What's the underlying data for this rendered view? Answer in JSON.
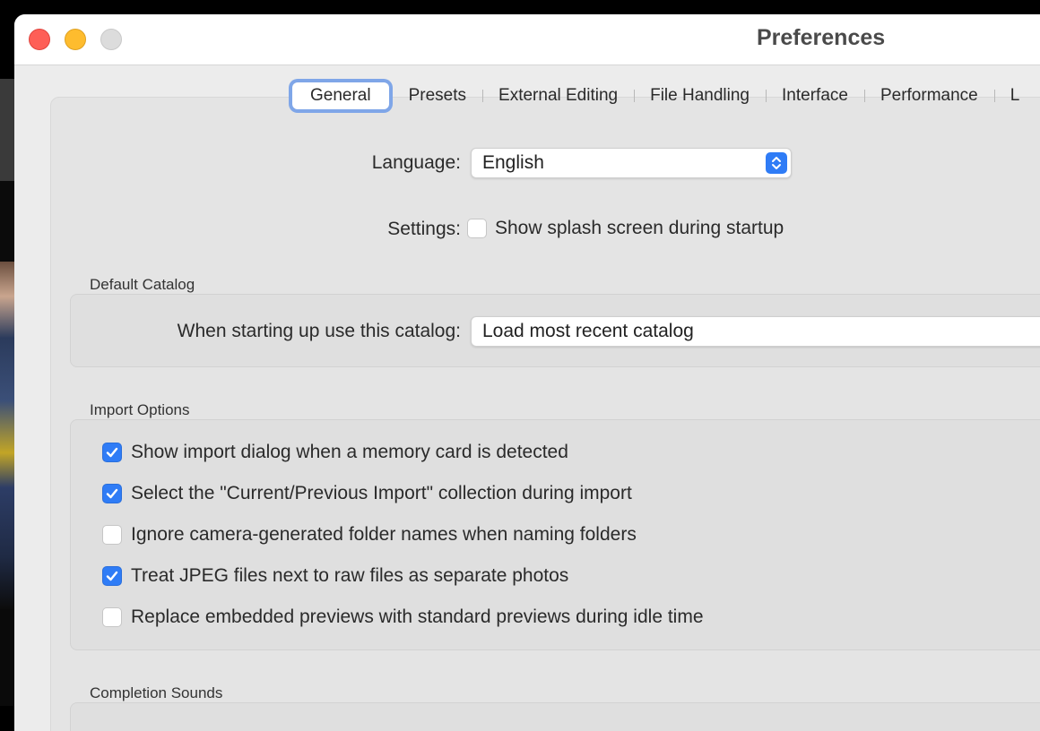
{
  "window": {
    "title": "Preferences"
  },
  "tabs": [
    {
      "label": "General",
      "active": true
    },
    {
      "label": "Presets",
      "active": false
    },
    {
      "label": "External Editing",
      "active": false
    },
    {
      "label": "File Handling",
      "active": false
    },
    {
      "label": "Interface",
      "active": false
    },
    {
      "label": "Performance",
      "active": false
    },
    {
      "label": "L",
      "active": false
    }
  ],
  "general": {
    "language_label": "Language:",
    "language_value": "English",
    "settings_label": "Settings:",
    "splash_label": "Show splash screen during startup",
    "splash_checked": false
  },
  "default_catalog": {
    "title": "Default Catalog",
    "label": "When starting up use this catalog:",
    "value": "Load most recent catalog"
  },
  "import_options": {
    "title": "Import Options",
    "items": [
      {
        "label": "Show import dialog when a memory card is detected",
        "checked": true
      },
      {
        "label": "Select the \"Current/Previous Import\" collection during import",
        "checked": true
      },
      {
        "label": "Ignore camera-generated folder names when naming folders",
        "checked": false
      },
      {
        "label": "Treat JPEG files next to raw files as separate photos",
        "checked": true
      },
      {
        "label": "Replace embedded previews with standard previews during idle time",
        "checked": false
      }
    ]
  },
  "completion_sounds": {
    "title": "Completion Sounds"
  },
  "colors": {
    "accent": "#2f7cf6",
    "focus_ring": "#7fa6e8"
  }
}
